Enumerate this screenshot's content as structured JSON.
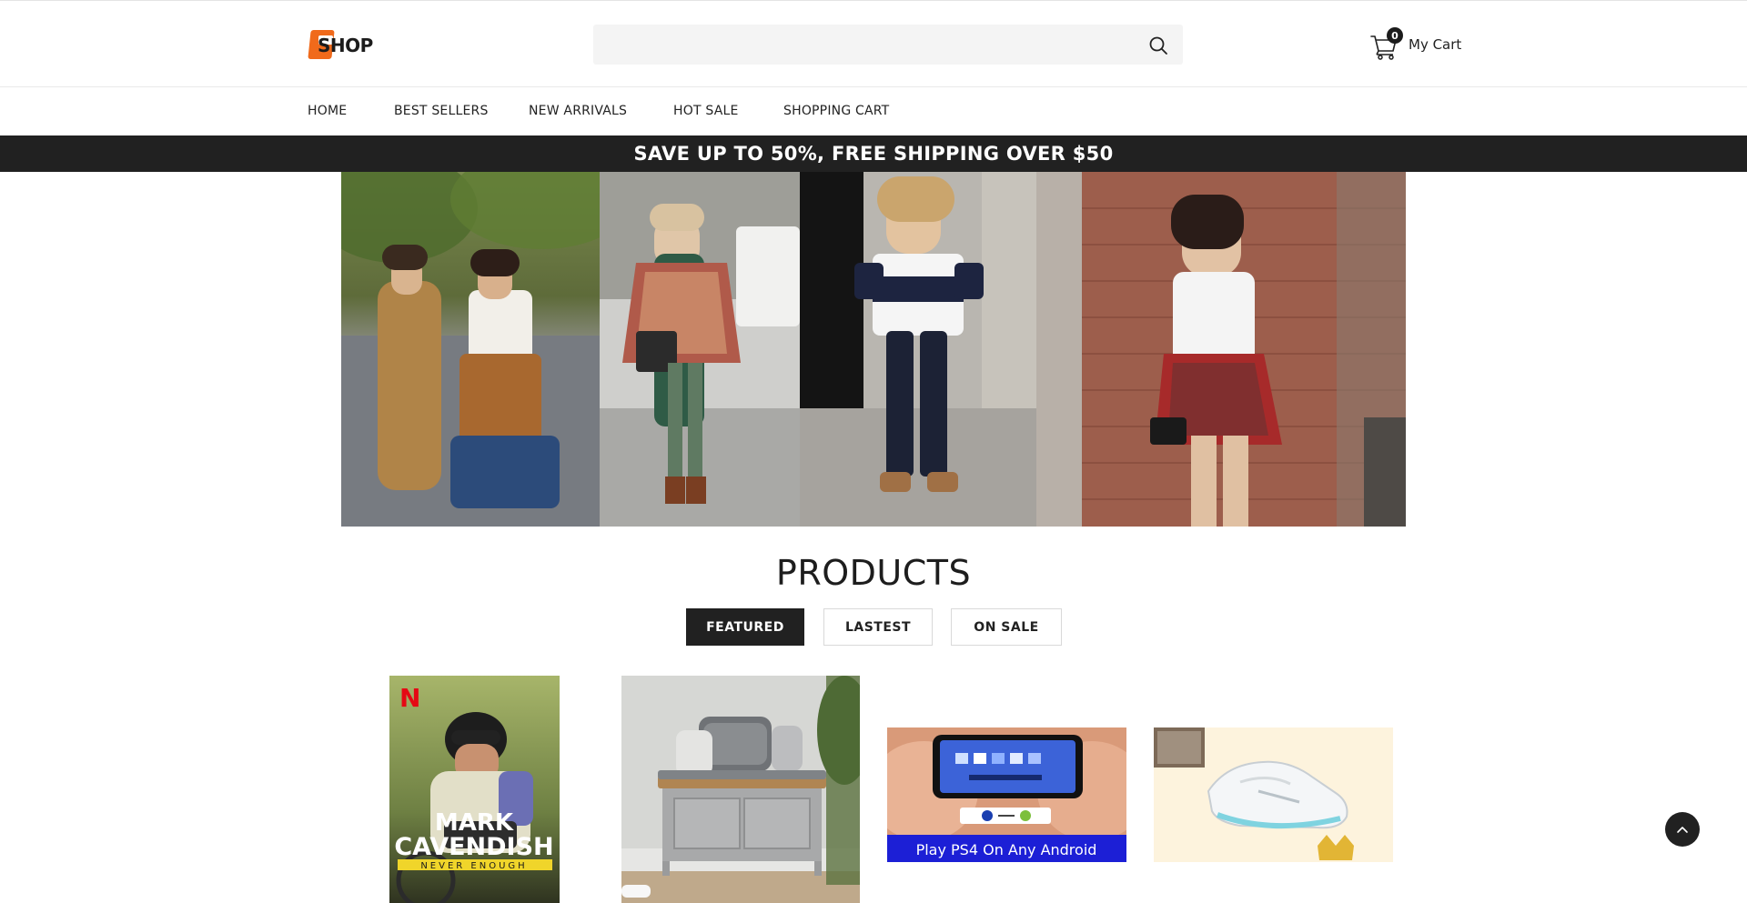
{
  "header": {
    "logo_text": "SHOP",
    "search": {
      "value": "",
      "placeholder": ""
    },
    "cart": {
      "count": "0",
      "label": "My Cart"
    }
  },
  "nav": {
    "items": [
      {
        "label": "HOME"
      },
      {
        "label": "BEST SELLERS"
      },
      {
        "label": "NEW ARRIVALS"
      },
      {
        "label": "HOT SALE"
      },
      {
        "label": "SHOPPING CART"
      }
    ]
  },
  "promo": {
    "text": "SAVE UP TO 50%, FREE SHIPPING OVER $50"
  },
  "products": {
    "title": "PRODUCTS",
    "tabs": [
      {
        "label": "FEATURED",
        "active": true
      },
      {
        "label": "LASTEST",
        "active": false
      },
      {
        "label": "ON SALE",
        "active": false
      }
    ],
    "items": [
      {
        "image_text_line1": "MARK",
        "image_text_line2": "CAVENDISH",
        "image_text_line3": "NEVER ENOUGH",
        "brand_mark": "N"
      },
      {
        "image_text": ""
      },
      {
        "image_caption": "Play PS4 On Any Android"
      },
      {
        "image_text": ""
      }
    ]
  },
  "colors": {
    "accent": "#f06a1b",
    "dark": "#212121",
    "netflix_red": "#e50914",
    "caption_blue": "#1c1fd6"
  }
}
